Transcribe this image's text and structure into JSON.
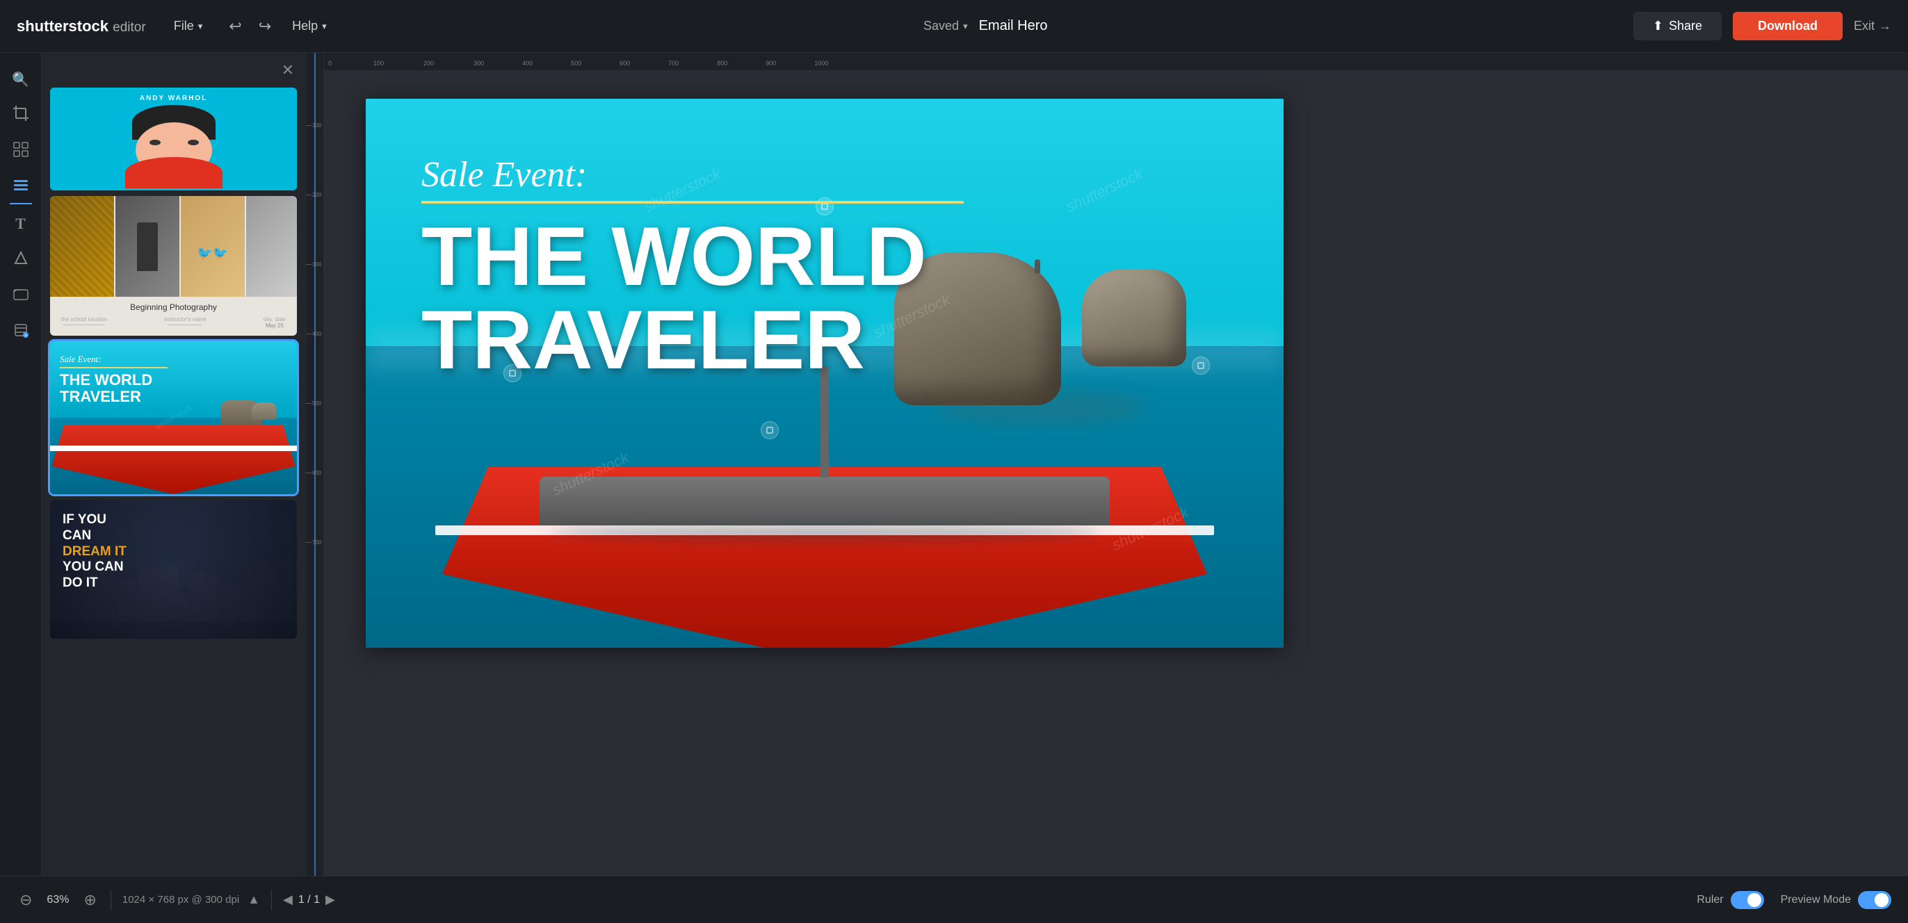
{
  "app": {
    "logo": "shutterstock",
    "editor_label": "editor",
    "file_menu": "File",
    "help_menu": "Help",
    "saved_label": "Saved",
    "doc_name": "Email Hero",
    "share_label": "Share",
    "download_label": "Download",
    "exit_label": "Exit"
  },
  "toolbar": {
    "undo_label": "↩",
    "redo_label": "↪"
  },
  "sidebar_icons": [
    {
      "name": "search",
      "symbol": "🔍",
      "active": false
    },
    {
      "name": "crop",
      "symbol": "⊞",
      "active": false
    },
    {
      "name": "texture",
      "symbol": "▦",
      "active": false
    },
    {
      "name": "panels",
      "symbol": "☰",
      "active": true
    },
    {
      "name": "text",
      "symbol": "T",
      "active": false
    },
    {
      "name": "shapes",
      "symbol": "△",
      "active": false
    },
    {
      "name": "folders",
      "symbol": "▭",
      "active": false
    },
    {
      "name": "layers",
      "symbol": "⊕",
      "active": false
    }
  ],
  "templates": [
    {
      "id": "tmpl1",
      "name": "Andy Warhol Style",
      "label": "ANDY WARHOL"
    },
    {
      "id": "tmpl2",
      "name": "Beginning Photography",
      "title": "Beginning Photography",
      "detail1_label": "the school location",
      "detail1_val": "—",
      "detail2_label": "instructor's name",
      "detail2_val": "—",
      "detail3_label": "day, date",
      "detail3_val": "May 25"
    },
    {
      "id": "tmpl3",
      "name": "World Traveler",
      "sale_text": "Sale Event:",
      "world_text": "THE WORLD",
      "traveler_text": "TRAVELER",
      "selected": true
    },
    {
      "id": "tmpl4",
      "name": "Dream It",
      "line1": "IF YOU",
      "line2": "CAN",
      "line3": "DREAM IT",
      "line4": "YOU CAN",
      "line5": "DO IT"
    }
  ],
  "canvas": {
    "sale_text": "Sale Event:",
    "world_line1": "THE WORLD",
    "world_line2": "TRAVELER",
    "watermarks": [
      "shutterstock",
      "shutterstock",
      "shutterstock",
      "shutterstock",
      "shutterstock"
    ]
  },
  "bottom_bar": {
    "zoom_out": "−",
    "zoom_in": "+",
    "zoom_value": "63%",
    "canvas_info": "1024 × 768 px @ 300 dpi",
    "page_up": "▲",
    "page_down": "▼",
    "page_info": "1 / 1",
    "ruler_label": "Ruler",
    "preview_label": "Preview Mode"
  },
  "ruler": {
    "horizontal_marks": [
      0,
      100,
      200,
      300,
      400,
      500,
      600,
      700,
      800,
      900,
      1000
    ],
    "vertical_marks": [
      100,
      200,
      300,
      400,
      500,
      600,
      700
    ]
  }
}
